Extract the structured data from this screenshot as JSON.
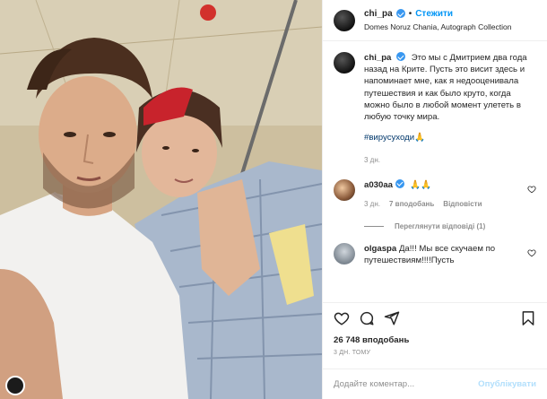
{
  "post": {
    "username": "chi_pa",
    "follow_label": "Стежити",
    "dot": "•",
    "location": "Domes Noruz Chania, Autograph Collection"
  },
  "caption": {
    "username": "chi_pa",
    "text": "Это мы с Дмитрием два года назад на Крите. Пусть это висит здесь и напоминает мне, как я недооценивала путешествия и как было круто, когда можно было в любой момент улететь в любую точку мира.",
    "hashtag": "#вирусуходи🙏",
    "time": "3 дн."
  },
  "comments": [
    {
      "username": "a030aa",
      "text": "🙏🙏",
      "time": "3 дн.",
      "likes": "7 вподобань",
      "reply_label": "Відповісти",
      "view_replies": "Переглянути відповіді (1)"
    },
    {
      "username": "olgaspa",
      "text": "Да!!! Мы все скучаем по путешествиям!!!!Пусть"
    }
  ],
  "footer": {
    "likes": "26 748 вподобань",
    "ago": "3 ДН. ТОМУ",
    "comment_placeholder": "Додайте коментар...",
    "publish_label": "Опублікувати"
  },
  "icons": {
    "like": "heart-icon",
    "comment": "comment-icon",
    "share": "share-icon",
    "save": "bookmark-icon"
  }
}
